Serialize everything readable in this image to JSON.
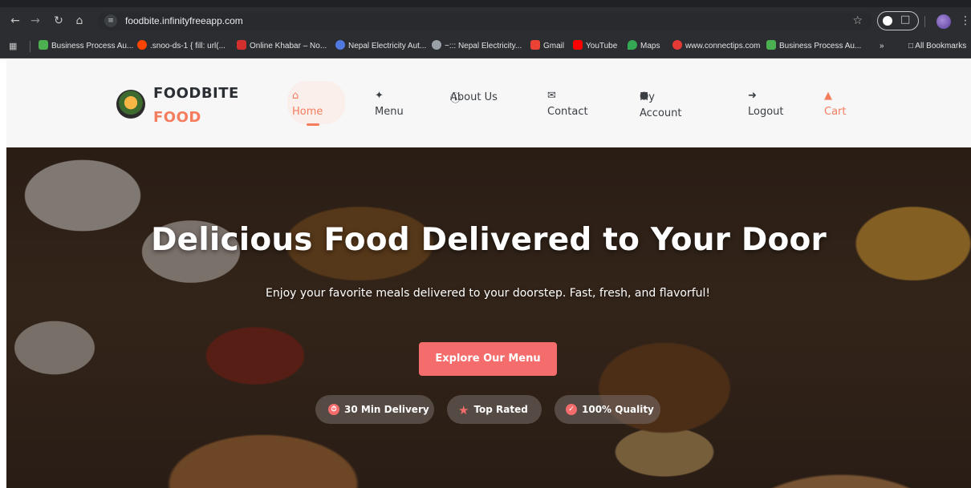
{
  "browser": {
    "url": "foodbite.infinityfreeapp.com",
    "bookmarks": [
      {
        "label": "Business Process Au...",
        "color": "#4caf50"
      },
      {
        "label": ".snoo-ds-1 { fill: url(...",
        "color": "#ff4500"
      },
      {
        "label": "Online Khabar – No...",
        "color": "#d32f2f"
      },
      {
        "label": "Nepal Electricity Aut...",
        "color": "#4f7be0"
      },
      {
        "label": "~::: Nepal Electricity...",
        "color": "#9aa0a6"
      },
      {
        "label": "Gmail",
        "color": "#ea4335"
      },
      {
        "label": "YouTube",
        "color": "#ff0000"
      },
      {
        "label": "Maps",
        "color": "#34a853"
      },
      {
        "label": "www.connectips.com",
        "color": "#e53935"
      },
      {
        "label": "Business Process Au...",
        "color": "#4caf50"
      }
    ],
    "overflow_label": "»",
    "all_bookmarks_label": "All Bookmarks"
  },
  "site": {
    "brand_line1": "FOODBITE",
    "brand_line2": "FOOD",
    "nav": [
      {
        "label": "Home",
        "icon": "home-icon",
        "active": true
      },
      {
        "label": "Menu",
        "icon": "utensils-icon"
      },
      {
        "label": "About Us",
        "icon": "info-icon"
      },
      {
        "label": "Contact",
        "icon": "envelope-icon"
      },
      {
        "label": "My Account",
        "icon": "user-icon"
      },
      {
        "label": "Logout",
        "icon": "logout-icon"
      },
      {
        "label": "Cart",
        "icon": "cart-icon"
      }
    ],
    "accent_color": "#f57c5d"
  },
  "hero": {
    "title": "Delicious Food Delivered to Your Door",
    "subtitle": "Enjoy your favorite meals delivered to your doorstep. Fast, fresh, and flavorful!",
    "cta_label": "Explore Our Menu",
    "cta_color": "#f46c6c",
    "badges": [
      {
        "label": "30 Min Delivery",
        "icon": "clock-icon"
      },
      {
        "label": "Top Rated",
        "icon": "star-icon"
      },
      {
        "label": "100% Quality",
        "icon": "check-circle-icon"
      }
    ]
  }
}
